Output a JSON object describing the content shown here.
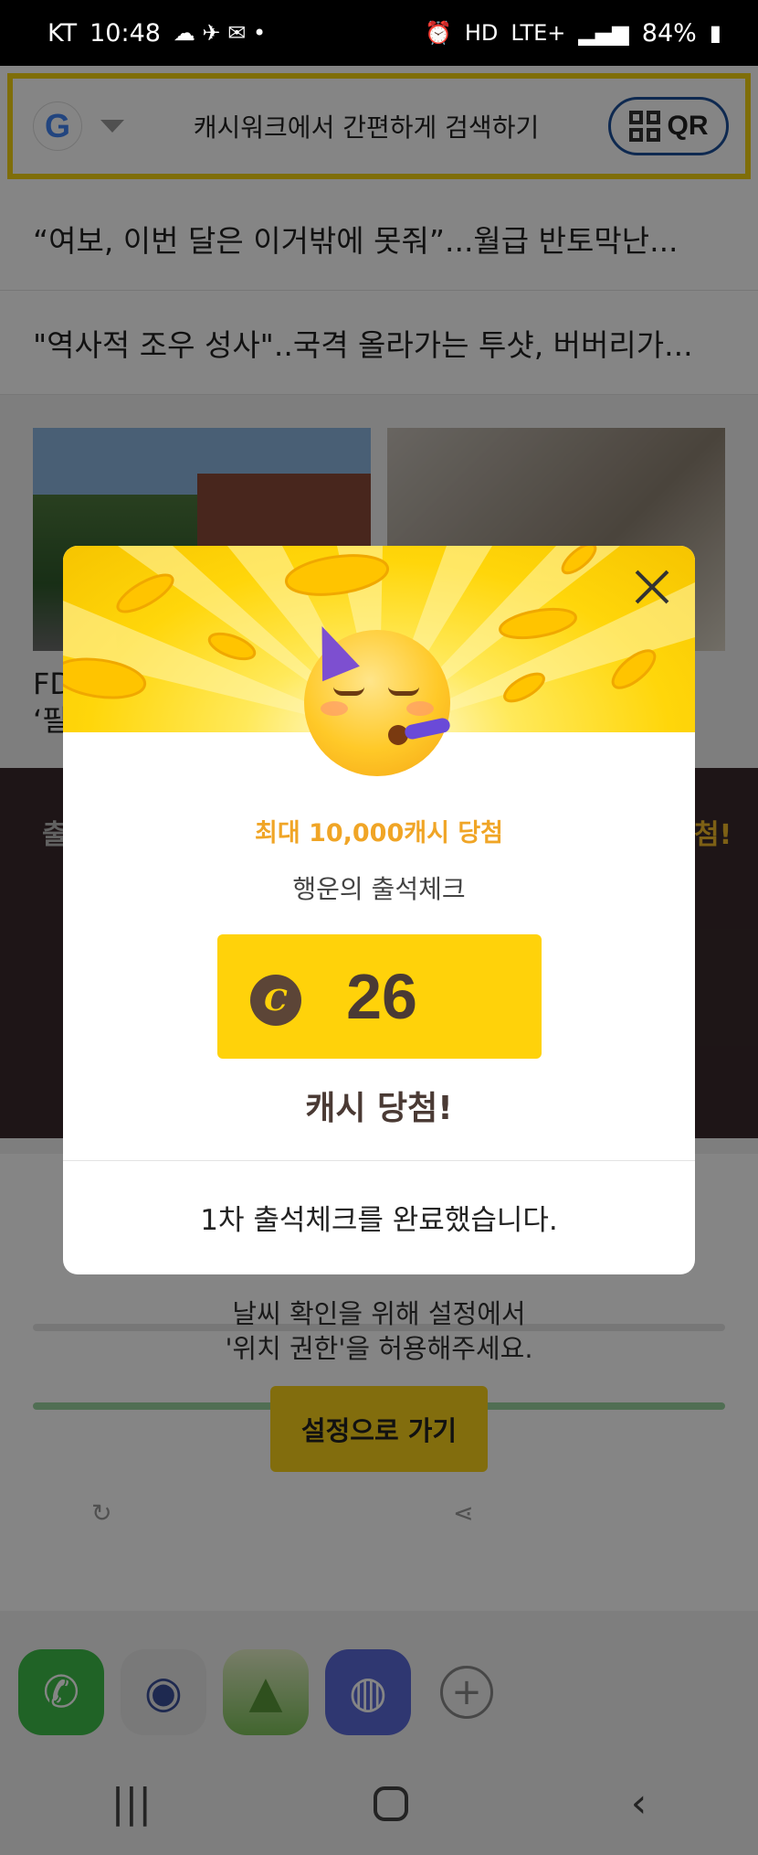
{
  "status_bar": {
    "carrier": "KT",
    "time": "10:48",
    "network": "LTE+",
    "battery": "84%"
  },
  "search": {
    "placeholder": "캐시워크에서 간편하게 검색하기",
    "qr_label": "QR"
  },
  "news": {
    "items": [
      "“여보, 이번 달은 이거밖에 못줘”...월급 반토막난...",
      "\"역사적 조우 성사\"..국격 올라가는 투샷, 버버리가..."
    ],
    "card_caption_1": "FD",
    "card_caption_2": "‘필"
  },
  "band": {
    "left_text": "출",
    "right_text": "첨!"
  },
  "weather": {
    "message_line1": "날씨 확인을 위해 설정에서",
    "message_line2": "'위치 권한'을 허용해주세요.",
    "settings_button": "설정으로 가기"
  },
  "popup": {
    "title": "최대 10,000캐시 당첨",
    "subtitle": "행운의 출석체크",
    "coin_symbol": "C",
    "amount": "26",
    "win_text": "캐시 당첨!",
    "footer": "1차 출석체크를 완료했습니다.",
    "accent_color": "#f0a526",
    "box_color": "#ffd20a"
  },
  "icons": [
    "google-logo",
    "qr-code-icon",
    "close-icon",
    "partying-face-emoji",
    "coin-icon",
    "phone-icon",
    "camera-icon",
    "gallery-icon",
    "internet-icon",
    "add-icon",
    "recents-icon",
    "home-icon",
    "back-icon"
  ]
}
